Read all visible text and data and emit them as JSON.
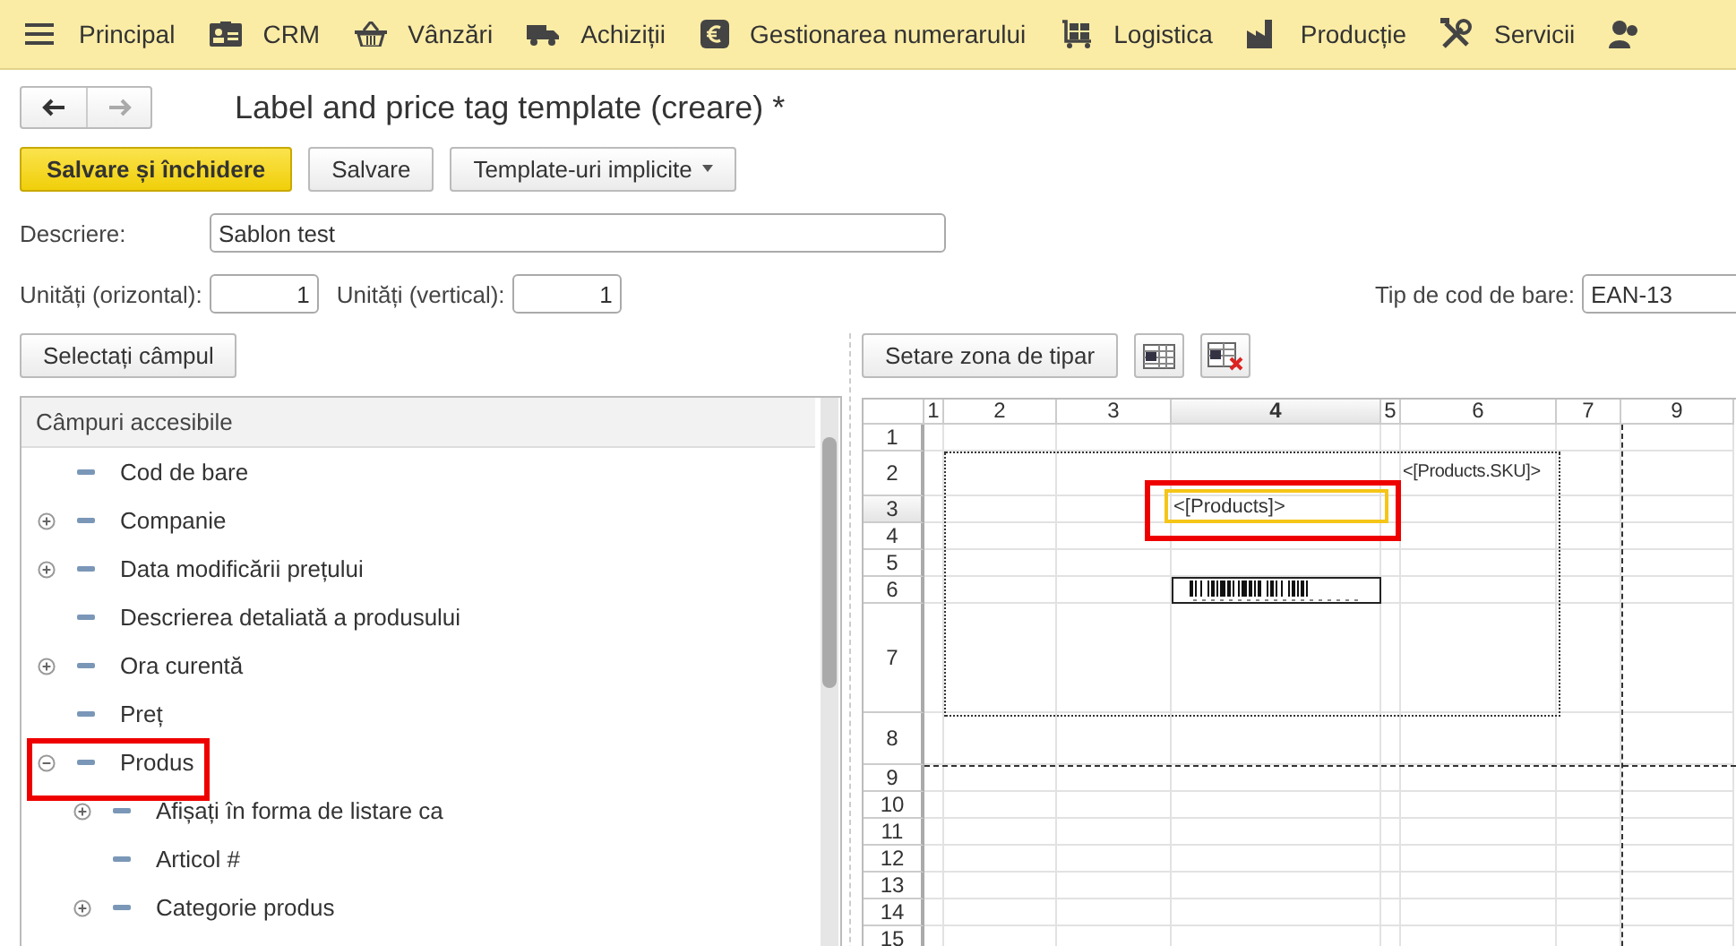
{
  "nav": [
    {
      "label": "Principal"
    },
    {
      "label": "CRM"
    },
    {
      "label": "Vânzări"
    },
    {
      "label": "Achiziții"
    },
    {
      "label": "Gestionarea numerarului"
    },
    {
      "label": "Logistica"
    },
    {
      "label": "Producție"
    },
    {
      "label": "Servicii"
    }
  ],
  "form": {
    "title": "Label and price tag template (creare) *",
    "buttons": [
      {
        "label": "Salvare și închidere",
        "kind": "primary"
      },
      {
        "label": "Salvare",
        "kind": "plain"
      },
      {
        "label": "Template-uri implicite",
        "kind": "dropdown"
      }
    ],
    "description": {
      "label": "Descriere:",
      "value": "Sablon test"
    },
    "units_h": {
      "label": "Unități (orizontal):",
      "value": "1"
    },
    "units_v": {
      "label": "Unități (vertical):",
      "value": "1"
    },
    "barcode_type": {
      "label": "Tip de cod de bare:",
      "value": "EAN-13"
    }
  },
  "fields_panel": {
    "button": "Selectați câmpul",
    "header": "Câmpuri accesibile",
    "items": [
      {
        "label": "Cod de bare",
        "kind": "leaf"
      },
      {
        "label": "Companie",
        "kind": "group",
        "expanded": false
      },
      {
        "label": "Data modificării prețului",
        "kind": "group",
        "expanded": false
      },
      {
        "label": "Descrierea detaliată a produsului",
        "kind": "leaf"
      },
      {
        "label": "Ora curentă",
        "kind": "group",
        "expanded": false
      },
      {
        "label": "Preț",
        "kind": "leaf"
      },
      {
        "label": "Produs",
        "kind": "group",
        "expanded": true,
        "highlighted": true,
        "children": [
          {
            "label": "Afișați în forma de listare ca",
            "kind": "group",
            "expanded": false
          },
          {
            "label": "Articol #",
            "kind": "leaf"
          },
          {
            "label": "Categorie produs",
            "kind": "group",
            "expanded": false
          }
        ]
      }
    ]
  },
  "layout_panel": {
    "button": "Setare zona de tipar",
    "columns": [
      {
        "label": "1",
        "selected": false
      },
      {
        "label": "2",
        "selected": false
      },
      {
        "label": "3",
        "selected": false
      },
      {
        "label": "4",
        "selected": true
      },
      {
        "label": "5",
        "selected": false
      },
      {
        "label": "6",
        "selected": false
      },
      {
        "label": "7",
        "selected": false
      },
      {
        "label": "9",
        "selected": false
      }
    ],
    "rows": [
      {
        "label": "1",
        "selected": false
      },
      {
        "label": "2",
        "selected": false
      },
      {
        "label": "3",
        "selected": true
      },
      {
        "label": "4",
        "selected": false
      },
      {
        "label": "5",
        "selected": false
      },
      {
        "label": "6",
        "selected": false
      },
      {
        "label": "7",
        "selected": false
      },
      {
        "label": "8",
        "selected": false
      },
      {
        "label": "9",
        "selected": false
      },
      {
        "label": "10",
        "selected": false
      },
      {
        "label": "11",
        "selected": false
      },
      {
        "label": "12",
        "selected": false
      },
      {
        "label": "13",
        "selected": false
      },
      {
        "label": "14",
        "selected": false
      },
      {
        "label": "15",
        "selected": false
      }
    ],
    "cells": [
      {
        "kind": "text",
        "text": "<[Products.SKU]>",
        "selected": false,
        "highlighted": false
      },
      {
        "kind": "text",
        "text": "<[Products]>",
        "selected": true,
        "highlighted": true
      },
      {
        "kind": "barcode",
        "selected": false,
        "highlighted": false
      }
    ]
  }
}
